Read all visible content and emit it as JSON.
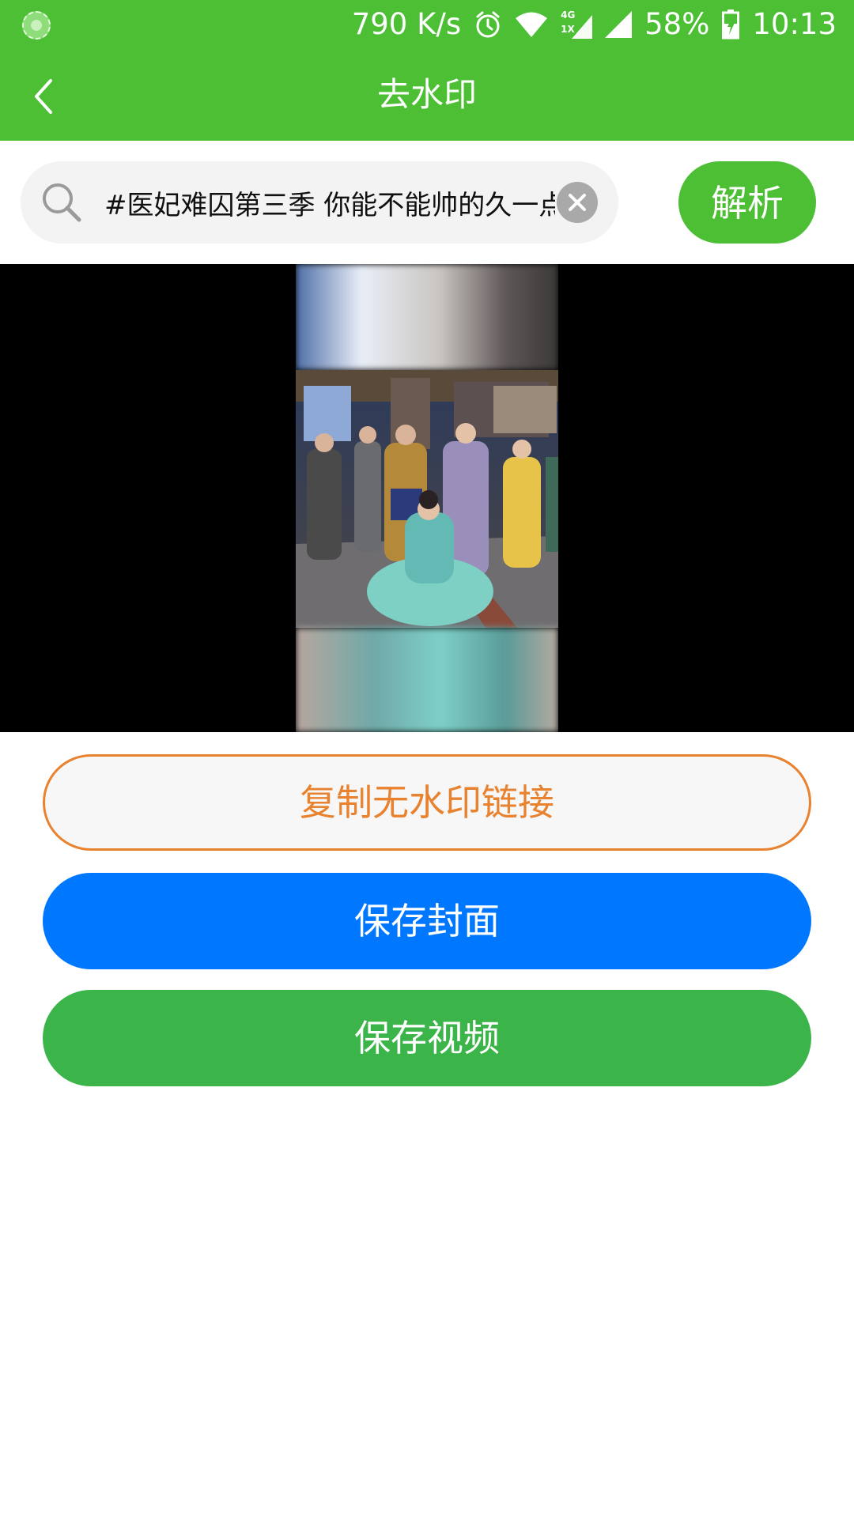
{
  "status_bar": {
    "network_speed": "790 K/s",
    "network_tag_top": "4G",
    "network_tag_bottom": "1X",
    "battery": "58%",
    "time": "10:13",
    "icons": [
      "app-logo-icon",
      "alarm-icon",
      "wifi-icon",
      "signal-4g-icon",
      "signal-icon",
      "battery-icon"
    ]
  },
  "app_bar": {
    "title": "去水印",
    "back_icon": "chevron-left-icon"
  },
  "search": {
    "value": "#医妃难囚第三季 你能不能帅的久一点",
    "search_icon": "search-icon",
    "clear_icon": "close-icon",
    "parse_label": "解析"
  },
  "video": {
    "description": "video-preview"
  },
  "actions": {
    "copy_link_label": "复制无水印链接",
    "save_cover_label": "保存封面",
    "save_video_label": "保存视频"
  },
  "colors": {
    "brand_green": "#4CBF34",
    "copy_orange": "#E8822F",
    "cover_blue": "#0077FF",
    "video_green": "#3BB54A"
  }
}
